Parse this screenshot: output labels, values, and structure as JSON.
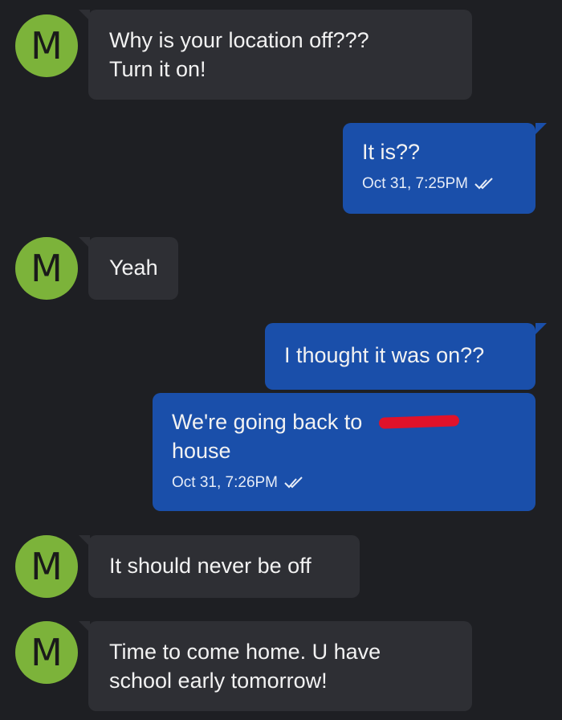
{
  "contact": {
    "avatar_initial": "M",
    "avatar_color": "#7cb33a"
  },
  "colors": {
    "background": "#1e1f23",
    "incoming_bubble": "#2e2f34",
    "outgoing_bubble": "#1a4faa"
  },
  "messages": [
    {
      "direction": "incoming",
      "text_line1": "Why is your location off???",
      "text_line2": "Turn it on!"
    },
    {
      "direction": "outgoing",
      "text": "It is??",
      "timestamp": "Oct 31, 7:25PM",
      "status_icon": "double-check-icon"
    },
    {
      "direction": "incoming",
      "text": "Yeah"
    },
    {
      "direction": "outgoing",
      "text": "I thought it was on??"
    },
    {
      "direction": "outgoing",
      "text_line1": "We're going back to",
      "text_line2": "house",
      "timestamp": "Oct 31, 7:26PM",
      "status_icon": "double-check-icon"
    },
    {
      "direction": "incoming",
      "text": "It should never be off"
    },
    {
      "direction": "incoming",
      "text_line1": "Time to come home.  U have",
      "text_line2": "school early tomorrow!"
    }
  ]
}
